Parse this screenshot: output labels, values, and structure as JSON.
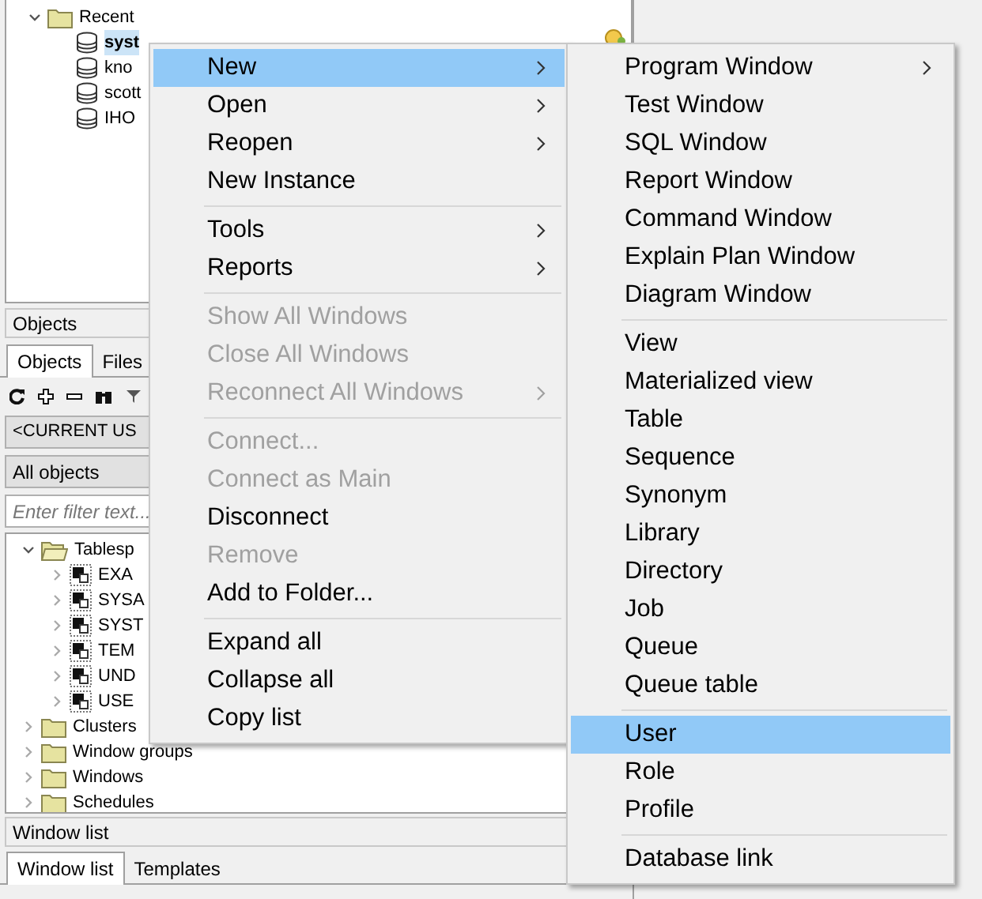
{
  "connections_tree": [
    {
      "label": "Recent",
      "kind": "folder",
      "expanded": true,
      "children": [
        {
          "label": "syst",
          "kind": "database",
          "selected": true
        },
        {
          "label": "kno",
          "kind": "database",
          "selected": false
        },
        {
          "label": "scott",
          "kind": "database",
          "selected": false
        },
        {
          "label": "IHO",
          "kind": "database",
          "selected": false
        }
      ]
    }
  ],
  "objects_panel": {
    "title": "Objects",
    "tabs": [
      {
        "label": "Objects",
        "selected": true
      },
      {
        "label": "Files",
        "selected": false
      }
    ],
    "user_select": {
      "value": "<CURRENT US"
    },
    "type_select": {
      "value": "All objects"
    },
    "filter": {
      "placeholder": "Enter filter text..."
    },
    "tree": [
      {
        "label": "Tablesp",
        "kind": "folder-open",
        "expanded": true,
        "children": [
          {
            "label": "EXA",
            "kind": "tablespace",
            "expanded": false
          },
          {
            "label": "SYSA",
            "kind": "tablespace",
            "expanded": false
          },
          {
            "label": "SYST",
            "kind": "tablespace",
            "expanded": false
          },
          {
            "label": "TEM",
            "kind": "tablespace",
            "expanded": false
          },
          {
            "label": "UND",
            "kind": "tablespace",
            "expanded": false
          },
          {
            "label": "USE",
            "kind": "tablespace",
            "expanded": false
          }
        ]
      },
      {
        "label": "Clusters",
        "kind": "folder",
        "expanded": false
      },
      {
        "label": "Window groups",
        "kind": "folder",
        "expanded": false
      },
      {
        "label": "Windows",
        "kind": "folder",
        "expanded": false
      },
      {
        "label": "Schedules",
        "kind": "folder",
        "expanded": false
      }
    ]
  },
  "window_list_panel": {
    "title": "Window list",
    "tabs": [
      {
        "label": "Window list",
        "selected": true
      },
      {
        "label": "Templates",
        "selected": false
      }
    ]
  },
  "context_menu": [
    {
      "kind": "item",
      "label": "New",
      "submenu": true,
      "disabled": false,
      "selected": true
    },
    {
      "kind": "item",
      "label": "Open",
      "submenu": true,
      "disabled": false,
      "selected": false
    },
    {
      "kind": "item",
      "label": "Reopen",
      "submenu": true,
      "disabled": false,
      "selected": false
    },
    {
      "kind": "item",
      "label": "New Instance",
      "submenu": false,
      "disabled": false,
      "selected": false
    },
    {
      "kind": "separator"
    },
    {
      "kind": "item",
      "label": "Tools",
      "submenu": true,
      "disabled": false,
      "selected": false
    },
    {
      "kind": "item",
      "label": "Reports",
      "submenu": true,
      "disabled": false,
      "selected": false
    },
    {
      "kind": "separator"
    },
    {
      "kind": "item",
      "label": "Show All Windows",
      "submenu": false,
      "disabled": true,
      "selected": false
    },
    {
      "kind": "item",
      "label": "Close All Windows",
      "submenu": false,
      "disabled": true,
      "selected": false
    },
    {
      "kind": "item",
      "label": "Reconnect All Windows",
      "submenu": true,
      "disabled": true,
      "selected": false
    },
    {
      "kind": "separator"
    },
    {
      "kind": "item",
      "label": "Connect...",
      "submenu": false,
      "disabled": true,
      "selected": false
    },
    {
      "kind": "item",
      "label": "Connect as Main",
      "submenu": false,
      "disabled": true,
      "selected": false
    },
    {
      "kind": "item",
      "label": "Disconnect",
      "submenu": false,
      "disabled": false,
      "selected": false
    },
    {
      "kind": "item",
      "label": "Remove",
      "submenu": false,
      "disabled": true,
      "selected": false
    },
    {
      "kind": "item",
      "label": "Add to Folder...",
      "submenu": false,
      "disabled": false,
      "selected": false
    },
    {
      "kind": "separator"
    },
    {
      "kind": "item",
      "label": "Expand all",
      "submenu": false,
      "disabled": false,
      "selected": false
    },
    {
      "kind": "item",
      "label": "Collapse all",
      "submenu": false,
      "disabled": false,
      "selected": false
    },
    {
      "kind": "item",
      "label": "Copy list",
      "submenu": false,
      "disabled": false,
      "selected": false
    }
  ],
  "new_submenu": [
    {
      "kind": "item",
      "label": "Program Window",
      "submenu": true,
      "disabled": false,
      "selected": false
    },
    {
      "kind": "item",
      "label": "Test Window",
      "submenu": false,
      "disabled": false,
      "selected": false
    },
    {
      "kind": "item",
      "label": "SQL Window",
      "submenu": false,
      "disabled": false,
      "selected": false
    },
    {
      "kind": "item",
      "label": "Report Window",
      "submenu": false,
      "disabled": false,
      "selected": false
    },
    {
      "kind": "item",
      "label": "Command Window",
      "submenu": false,
      "disabled": false,
      "selected": false
    },
    {
      "kind": "item",
      "label": "Explain Plan Window",
      "submenu": false,
      "disabled": false,
      "selected": false
    },
    {
      "kind": "item",
      "label": "Diagram Window",
      "submenu": false,
      "disabled": false,
      "selected": false
    },
    {
      "kind": "separator"
    },
    {
      "kind": "item",
      "label": "View",
      "submenu": false,
      "disabled": false,
      "selected": false
    },
    {
      "kind": "item",
      "label": "Materialized view",
      "submenu": false,
      "disabled": false,
      "selected": false
    },
    {
      "kind": "item",
      "label": "Table",
      "submenu": false,
      "disabled": false,
      "selected": false
    },
    {
      "kind": "item",
      "label": "Sequence",
      "submenu": false,
      "disabled": false,
      "selected": false
    },
    {
      "kind": "item",
      "label": "Synonym",
      "submenu": false,
      "disabled": false,
      "selected": false
    },
    {
      "kind": "item",
      "label": "Library",
      "submenu": false,
      "disabled": false,
      "selected": false
    },
    {
      "kind": "item",
      "label": "Directory",
      "submenu": false,
      "disabled": false,
      "selected": false
    },
    {
      "kind": "item",
      "label": "Job",
      "submenu": false,
      "disabled": false,
      "selected": false
    },
    {
      "kind": "item",
      "label": "Queue",
      "submenu": false,
      "disabled": false,
      "selected": false
    },
    {
      "kind": "item",
      "label": "Queue table",
      "submenu": false,
      "disabled": false,
      "selected": false
    },
    {
      "kind": "separator"
    },
    {
      "kind": "item",
      "label": "User",
      "submenu": false,
      "disabled": false,
      "selected": true
    },
    {
      "kind": "item",
      "label": "Role",
      "submenu": false,
      "disabled": false,
      "selected": false
    },
    {
      "kind": "item",
      "label": "Profile",
      "submenu": false,
      "disabled": false,
      "selected": false
    },
    {
      "kind": "separator"
    },
    {
      "kind": "item",
      "label": "Database link",
      "submenu": false,
      "disabled": false,
      "selected": false
    }
  ]
}
